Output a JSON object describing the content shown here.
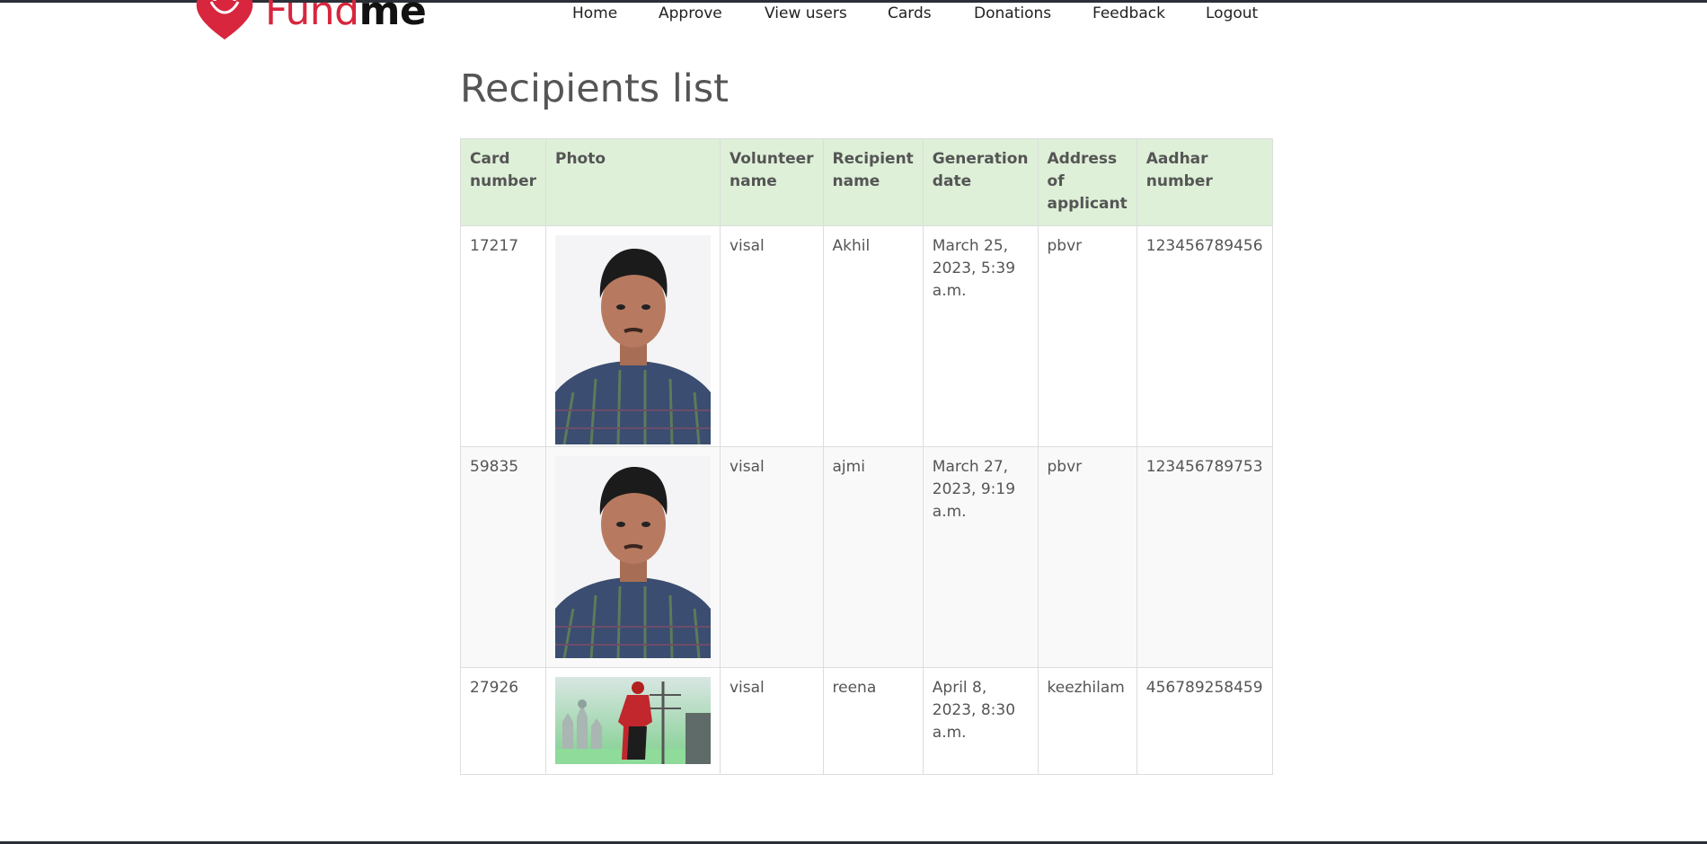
{
  "brand": {
    "fund": "Fund",
    "me": "me",
    "accent": "#d7263d"
  },
  "nav": {
    "items": [
      {
        "label": "Home"
      },
      {
        "label": "Approve"
      },
      {
        "label": "View users"
      },
      {
        "label": "Cards"
      },
      {
        "label": "Donations"
      },
      {
        "label": "Feedback"
      },
      {
        "label": "Logout"
      }
    ]
  },
  "page": {
    "title": "Recipients list"
  },
  "table": {
    "header_bg": "#def0d8",
    "columns": [
      "Card number",
      "Photo",
      "Volunteer name",
      "Recipient name",
      "Generation date",
      "Address of applicant",
      "Aadhar number"
    ],
    "rows": [
      {
        "card_number": "17217",
        "photo": "portrait-photo",
        "volunteer": "visal",
        "recipient": "Akhil",
        "date": "March 25, 2023, 5:39 a.m.",
        "address": "pbvr",
        "aadhar": "123456789456"
      },
      {
        "card_number": "59835",
        "photo": "portrait-photo",
        "volunteer": "visal",
        "recipient": "ajmi",
        "date": "March 27, 2023, 9:19 a.m.",
        "address": "pbvr",
        "aadhar": "123456789753"
      },
      {
        "card_number": "27926",
        "photo": "landscape-photo",
        "volunteer": "visal",
        "recipient": "reena",
        "date": "April 8, 2023, 8:30 a.m.",
        "address": "keezhilam",
        "aadhar": "456789258459"
      }
    ]
  }
}
